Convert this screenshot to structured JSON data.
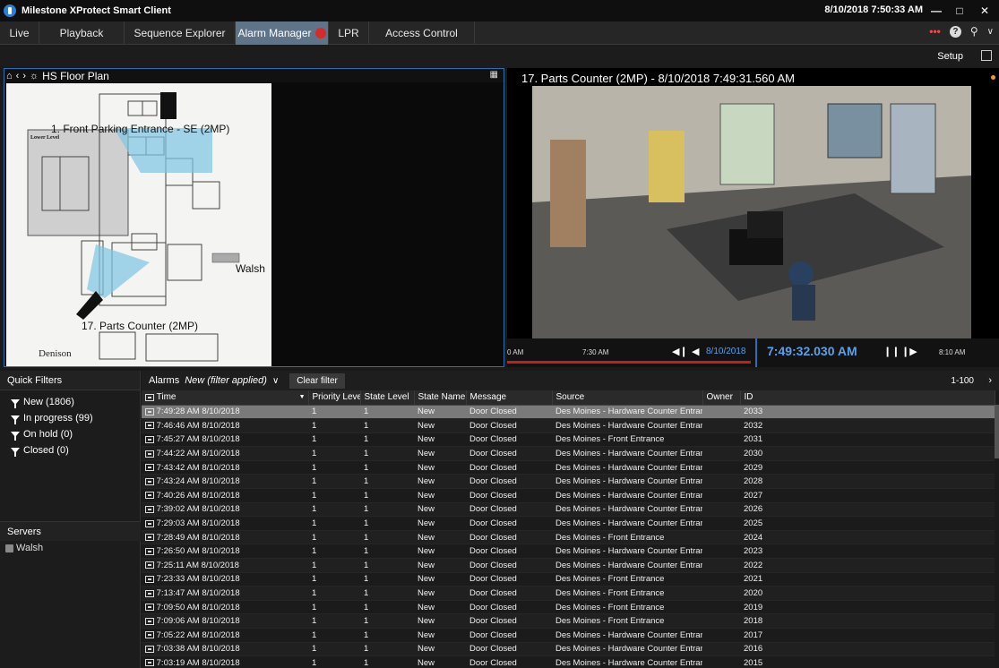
{
  "window": {
    "app_title": "Milestone XProtect Smart Client",
    "clock": "8/10/2018 7:50:33 AM"
  },
  "nav": {
    "tabs": [
      "Live",
      "Playback",
      "Sequence Explorer",
      "Alarm Manager",
      "LPR",
      "Access Control"
    ],
    "active_tab": "Alarm Manager",
    "setup_label": "Setup"
  },
  "floor_plan": {
    "title": "HS Floor Plan",
    "cam1_label": "1. Front Parking Entrance - SE (2MP)",
    "cam2_label": "17. Parts Counter (2MP)",
    "server_label": "Walsh",
    "lower_level": "Lower Level",
    "bottom_text": "Denison"
  },
  "camera": {
    "title": "17. Parts Counter (2MP) - 8/10/2018 7:49:31.560 AM",
    "timeline": {
      "left_label": "0 AM",
      "mid_label": "7:30 AM",
      "date": "8/10/2018",
      "current_time": "7:49:32.030 AM",
      "right_label": "8:10 AM"
    }
  },
  "sidebar": {
    "quick_filters_title": "Quick Filters",
    "filters": [
      "New (1806)",
      "In progress (99)",
      "On hold (0)",
      "Closed (0)"
    ],
    "servers_title": "Servers",
    "server": "Walsh"
  },
  "alarms": {
    "label": "Alarms",
    "filter_name": "New (filter applied)",
    "clear_filter": "Clear filter",
    "range": "1-100",
    "columns": [
      "Time",
      "Priority Level",
      "State Level",
      "State Name",
      "Message",
      "Source",
      "Owner",
      "ID"
    ],
    "rows": [
      [
        "7:49:28 AM 8/10/2018",
        "1",
        "1",
        "New",
        "Door Closed",
        "Des Moines - Hardware Counter Entrance",
        "",
        "2033"
      ],
      [
        "7:46:46 AM 8/10/2018",
        "1",
        "1",
        "New",
        "Door Closed",
        "Des Moines - Hardware Counter Entrance",
        "",
        "2032"
      ],
      [
        "7:45:27 AM 8/10/2018",
        "1",
        "1",
        "New",
        "Door Closed",
        "Des Moines - Front Entrance",
        "",
        "2031"
      ],
      [
        "7:44:22 AM 8/10/2018",
        "1",
        "1",
        "New",
        "Door Closed",
        "Des Moines - Hardware Counter Entrance",
        "",
        "2030"
      ],
      [
        "7:43:42 AM 8/10/2018",
        "1",
        "1",
        "New",
        "Door Closed",
        "Des Moines - Hardware Counter Entrance",
        "",
        "2029"
      ],
      [
        "7:43:24 AM 8/10/2018",
        "1",
        "1",
        "New",
        "Door Closed",
        "Des Moines - Hardware Counter Entrance",
        "",
        "2028"
      ],
      [
        "7:40:26 AM 8/10/2018",
        "1",
        "1",
        "New",
        "Door Closed",
        "Des Moines - Hardware Counter Entrance",
        "",
        "2027"
      ],
      [
        "7:39:02 AM 8/10/2018",
        "1",
        "1",
        "New",
        "Door Closed",
        "Des Moines - Hardware Counter Entrance",
        "",
        "2026"
      ],
      [
        "7:29:03 AM 8/10/2018",
        "1",
        "1",
        "New",
        "Door Closed",
        "Des Moines - Hardware Counter Entrance",
        "",
        "2025"
      ],
      [
        "7:28:49 AM 8/10/2018",
        "1",
        "1",
        "New",
        "Door Closed",
        "Des Moines - Front Entrance",
        "",
        "2024"
      ],
      [
        "7:26:50 AM 8/10/2018",
        "1",
        "1",
        "New",
        "Door Closed",
        "Des Moines - Hardware Counter Entrance",
        "",
        "2023"
      ],
      [
        "7:25:11 AM 8/10/2018",
        "1",
        "1",
        "New",
        "Door Closed",
        "Des Moines - Hardware Counter Entrance",
        "",
        "2022"
      ],
      [
        "7:23:33 AM 8/10/2018",
        "1",
        "1",
        "New",
        "Door Closed",
        "Des Moines - Front Entrance",
        "",
        "2021"
      ],
      [
        "7:13:47 AM 8/10/2018",
        "1",
        "1",
        "New",
        "Door Closed",
        "Des Moines - Front Entrance",
        "",
        "2020"
      ],
      [
        "7:09:50 AM 8/10/2018",
        "1",
        "1",
        "New",
        "Door Closed",
        "Des Moines - Front Entrance",
        "",
        "2019"
      ],
      [
        "7:09:06 AM 8/10/2018",
        "1",
        "1",
        "New",
        "Door Closed",
        "Des Moines - Front Entrance",
        "",
        "2018"
      ],
      [
        "7:05:22 AM 8/10/2018",
        "1",
        "1",
        "New",
        "Door Closed",
        "Des Moines - Hardware Counter Entrance",
        "",
        "2017"
      ],
      [
        "7:03:38 AM 8/10/2018",
        "1",
        "1",
        "New",
        "Door Closed",
        "Des Moines - Hardware Counter Entrance",
        "",
        "2016"
      ],
      [
        "7:03:19 AM 8/10/2018",
        "1",
        "1",
        "New",
        "Door Closed",
        "Des Moines - Hardware Counter Entrance",
        "",
        "2015"
      ]
    ]
  }
}
